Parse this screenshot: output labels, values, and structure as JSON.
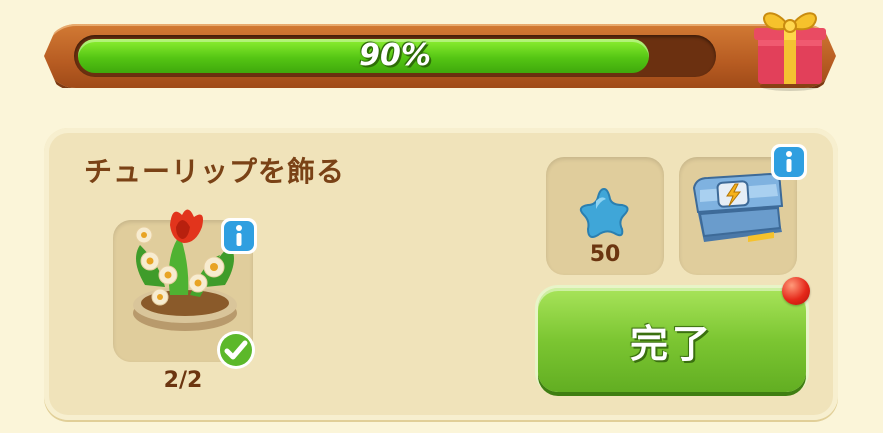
{
  "progress": {
    "value": 0.9,
    "label": "90%"
  },
  "task": {
    "title": "チューリップを飾る",
    "item": {
      "icon": "tulip-flower-planter",
      "count": "2/2",
      "completed": true
    }
  },
  "rewards": [
    {
      "icon": "blue-star",
      "amount": "50"
    },
    {
      "icon": "energy-chest",
      "amount": ""
    }
  ],
  "complete_button": {
    "label": "完了"
  },
  "colors": {
    "accent_green": "#7cc632",
    "frame_orange": "#b75c22",
    "title_brown": "#7a4216",
    "notify_red": "#e5281a"
  }
}
